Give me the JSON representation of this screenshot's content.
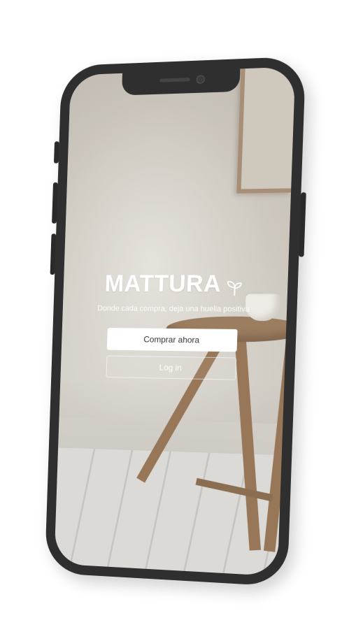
{
  "app": {
    "brand_name": "MATTURA",
    "brand_icon": "sprout-icon",
    "tagline": "Donde cada compra, deja una huella positiva"
  },
  "actions": {
    "primary_label": "Comprar ahora",
    "secondary_label": "Log in"
  },
  "colors": {
    "device_frame": "#2f2f2f",
    "primary_button_bg": "#ffffff",
    "primary_button_text": "#333333",
    "text_on_image": "#ffffff"
  }
}
